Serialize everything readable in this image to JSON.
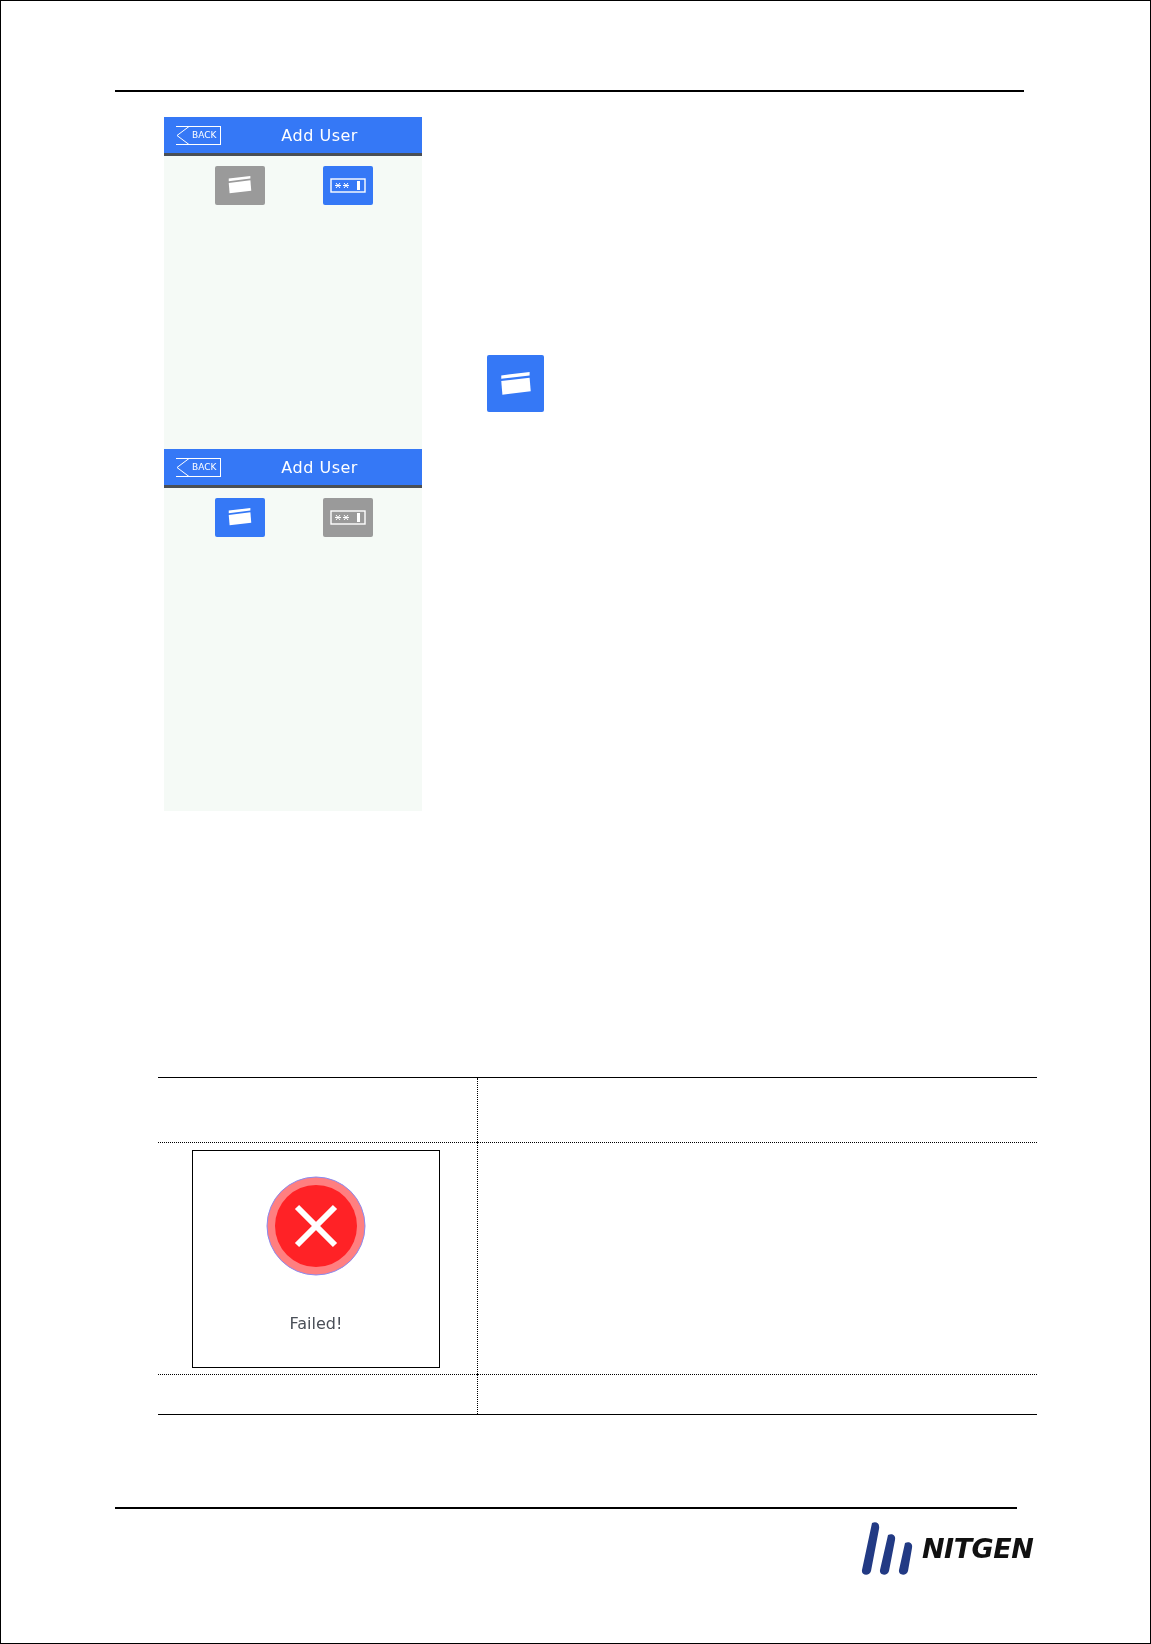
{
  "screens": [
    {
      "title": "Add User",
      "back_label": "BACK",
      "modes": [
        {
          "kind": "card",
          "selected": false
        },
        {
          "kind": "password",
          "selected": true
        }
      ]
    },
    {
      "title": "Add User",
      "back_label": "BACK",
      "modes": [
        {
          "kind": "card",
          "selected": true
        },
        {
          "kind": "password",
          "selected": false
        }
      ]
    }
  ],
  "failed_dialog": {
    "message": "Failed!"
  },
  "logo": {
    "text": "NITGEN"
  }
}
